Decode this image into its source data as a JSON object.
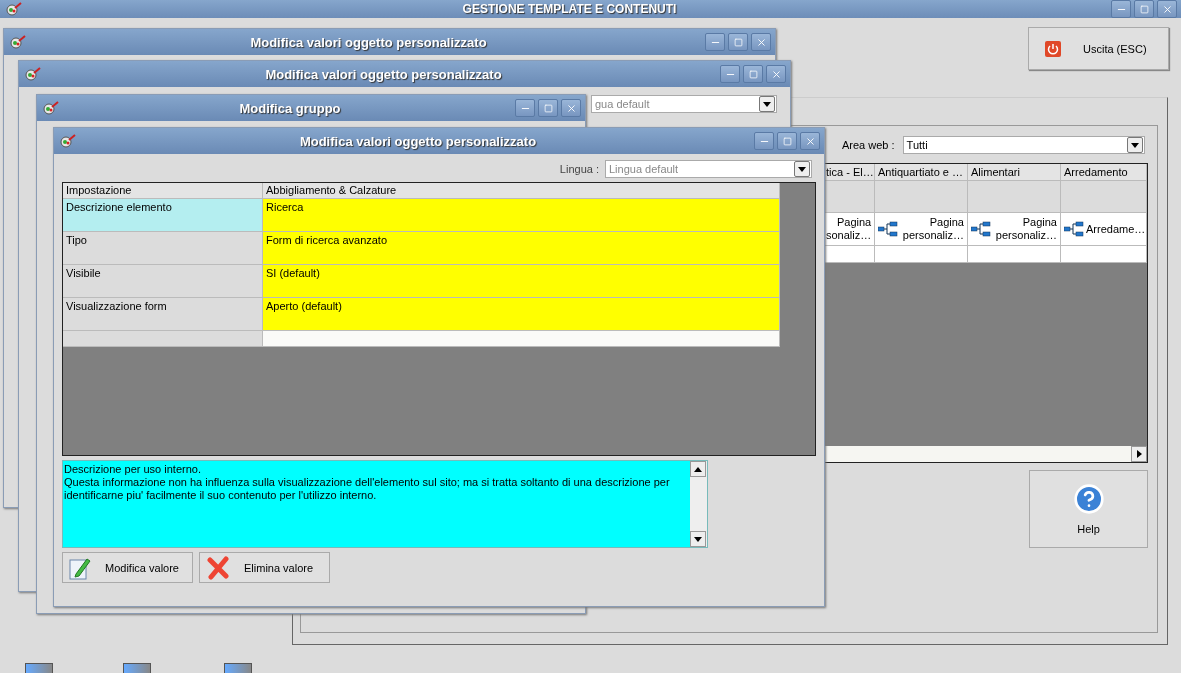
{
  "main_window": {
    "title": "GESTIONE TEMPLATE E CONTENUTI",
    "exit_button": "Uscita (ESC)",
    "help_button": "Help",
    "area_web": {
      "label": "Area web :",
      "value": "Tutti"
    },
    "grid": {
      "columns": [
        "tica - El…",
        "Antiquartiato e …",
        "Alimentari",
        "Arredamento"
      ],
      "cells": [
        {
          "line1": "Pagina",
          "line2": "sonaliz…",
          "icon": false
        },
        {
          "line1": "Pagina",
          "line2": "personaliz…",
          "icon": true
        },
        {
          "line1": "Pagina",
          "line2": "personaliz…",
          "icon": true
        },
        {
          "line1": "Arredame…",
          "icon": true
        }
      ]
    }
  },
  "back_windows": [
    {
      "title": "Modifica valori oggetto personalizzato"
    },
    {
      "title": "Modifica valori oggetto personalizzato",
      "lingua_value": "gua default"
    },
    {
      "title": "Modifica gruppo"
    }
  ],
  "front_window": {
    "title": "Modifica valori oggetto personalizzato",
    "lingua": {
      "label": "Lingua :",
      "value": "Lingua default"
    },
    "columns": [
      "Impostazione",
      "Abbigliamento & Calzature"
    ],
    "rows": [
      {
        "setting": "Descrizione elemento",
        "value": "Ricerca",
        "selected": true
      },
      {
        "setting": "Tipo",
        "value": "Form di ricerca avanzato",
        "selected": false
      },
      {
        "setting": "Visibile",
        "value": "SI (default)",
        "selected": false
      },
      {
        "setting": "Visualizzazione form",
        "value": "Aperto (default)",
        "selected": false
      }
    ],
    "description": "Descrizione per uso interno.\nQuesta informazione non ha influenza sulla visualizzazione dell'elemento sul sito; ma si tratta soltanto di una descrizione per identificarne piu' facilmente il suo contenuto per l'utilizzo interno.",
    "buttons": [
      {
        "label": "Modifica valore",
        "kind": "edit"
      },
      {
        "label": "Elimina valore",
        "kind": "delete"
      }
    ]
  }
}
